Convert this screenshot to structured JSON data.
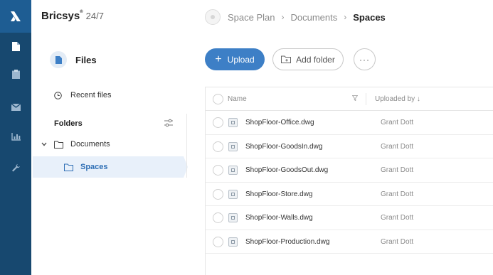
{
  "header": {
    "brand": "Bricsys",
    "brand_suffix": "24/7",
    "breadcrumb": [
      "Space Plan",
      "Documents",
      "Spaces"
    ]
  },
  "sidebar": {
    "icons": [
      "bricsys-logo-icon",
      "document-icon",
      "clipboard-icon",
      "mail-icon",
      "chart-icon",
      "wrench-icon"
    ],
    "files_title": "Files",
    "recent_files": "Recent files",
    "folders_heading": "Folders",
    "tree": [
      {
        "label": "Documents",
        "expanded": true
      },
      {
        "label": "Spaces",
        "selected": true
      }
    ]
  },
  "toolbar": {
    "upload_label": "Upload",
    "add_folder_label": "Add folder",
    "more_label": "···"
  },
  "table": {
    "columns": [
      "Name",
      "Uploaded by ↓"
    ],
    "rows": [
      {
        "name": "ShopFloor-Office.dwg",
        "uploaded_by": "Grant Dott"
      },
      {
        "name": "ShopFloor-GoodsIn.dwg",
        "uploaded_by": "Grant Dott"
      },
      {
        "name": "ShopFloor-GoodsOut.dwg",
        "uploaded_by": "Grant Dott"
      },
      {
        "name": "ShopFloor-Store.dwg",
        "uploaded_by": "Grant Dott"
      },
      {
        "name": "ShopFloor-Walls.dwg",
        "uploaded_by": "Grant Dott"
      },
      {
        "name": "ShopFloor-Production.dwg",
        "uploaded_by": "Grant Dott"
      }
    ]
  },
  "colors": {
    "rail": "#17486f",
    "accent": "#3d7fc6",
    "selected_bg": "#e8f0fa"
  }
}
